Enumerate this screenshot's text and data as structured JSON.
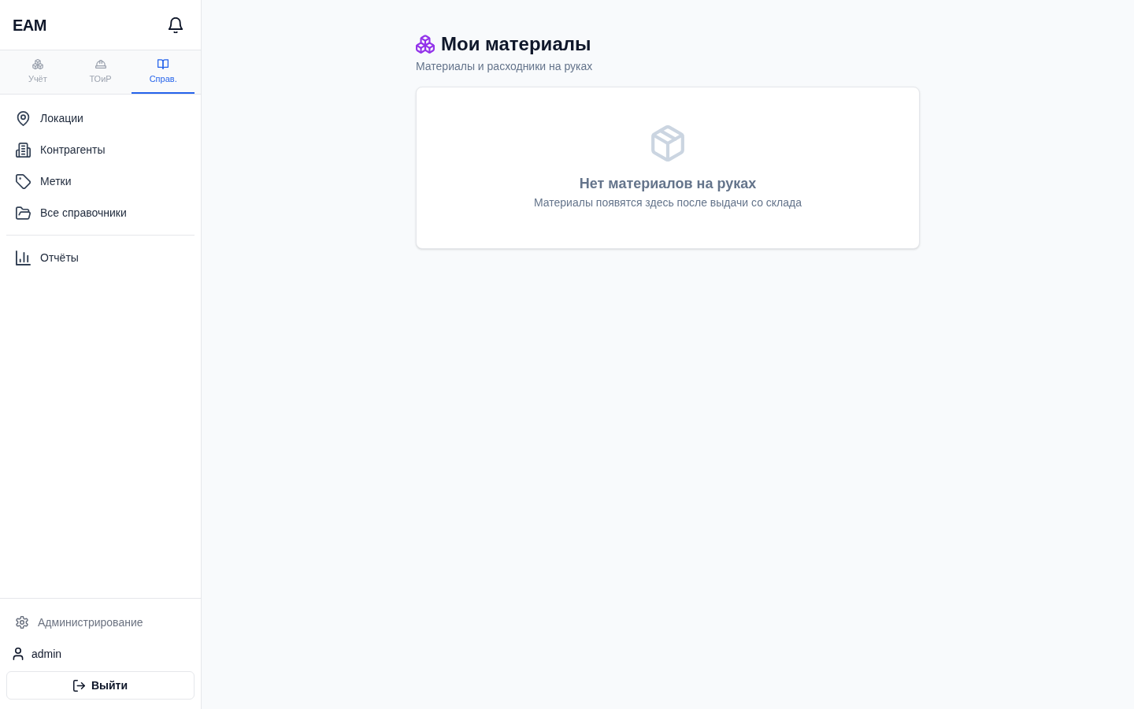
{
  "sidebar": {
    "brand": "EAM",
    "tabs": [
      {
        "label": "Учёт",
        "selected": false
      },
      {
        "label": "ТОиР",
        "selected": false
      },
      {
        "label": "Справ.",
        "selected": true
      }
    ],
    "nav_groups": [
      {
        "items": [
          {
            "label": "Локации"
          },
          {
            "label": "Контрагенты"
          },
          {
            "label": "Метки"
          },
          {
            "label": "Все справочники"
          }
        ]
      },
      {
        "items": [
          {
            "label": "Отчёты"
          }
        ]
      }
    ],
    "footer": {
      "admin_link": "Администрирование",
      "user": "admin",
      "logout_button": "Выйти"
    }
  },
  "main": {
    "title": "Мои материалы",
    "subtitle": "Материалы и расходники на руках",
    "empty_state": {
      "heading": "Нет материалов на руках",
      "description": "Материалы появятся здесь после выдачи со склада"
    }
  }
}
